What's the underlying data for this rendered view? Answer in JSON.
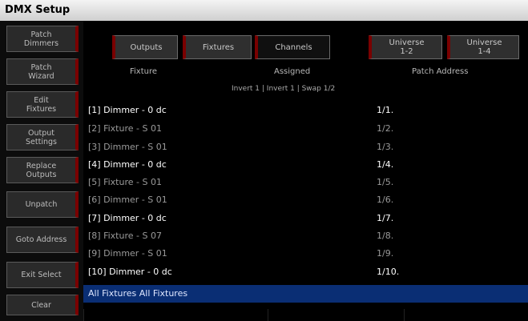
{
  "window": {
    "title": "DMX Setup"
  },
  "sidebar": {
    "items": [
      {
        "label": "Patch\nDimmers"
      },
      {
        "label": "Patch\nWizard"
      },
      {
        "label": "Edit\nFixtures"
      },
      {
        "label": "Output\nSettings"
      },
      {
        "label": "Replace\nOutputs"
      },
      {
        "label": "Unpatch"
      },
      {
        "label": "Goto Address"
      },
      {
        "label": "Exit Select"
      },
      {
        "label": "Clear"
      }
    ]
  },
  "tabs": [
    {
      "label": "Outputs"
    },
    {
      "label": "Fixtures"
    },
    {
      "label": "Channels"
    },
    {
      "label": "Universe\n1-2"
    },
    {
      "label": "Universe\n1-4"
    }
  ],
  "table": {
    "headers": {
      "fixture": "Fixture",
      "assigned": "Assigned",
      "address": "Patch Address"
    },
    "subheader": "Invert 1 | Invert 1 | Swap 1/2",
    "rows": [
      {
        "name": "[1] Dimmer - 0 dc",
        "addr": "1/1."
      },
      {
        "name": "[2] Fixture - S 01",
        "addr": "1/2."
      },
      {
        "name": "[3] Dimmer - S 01",
        "addr": "1/3."
      },
      {
        "name": "[4] Dimmer - 0 dc",
        "addr": "1/4."
      },
      {
        "name": "[5] Fixture - S 01",
        "addr": "1/5."
      },
      {
        "name": "[6] Dimmer - S 01",
        "addr": "1/6."
      },
      {
        "name": "[7] Dimmer - 0 dc",
        "addr": "1/7."
      },
      {
        "name": "[8] Fixture - S 07",
        "addr": "1/8."
      },
      {
        "name": "[9] Dimmer - S 01",
        "addr": "1/9."
      },
      {
        "name": "[10] Dimmer - 0 dc",
        "addr": "1/10."
      }
    ]
  },
  "selection": {
    "text": "All Fixtures  All Fixtures"
  }
}
